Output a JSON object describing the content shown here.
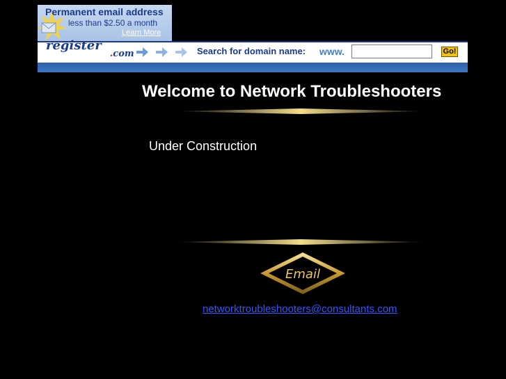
{
  "ad": {
    "title": "Permanent email address",
    "subtitle": "less than $2.50 a month",
    "learn_more": "Learn More"
  },
  "banner": {
    "logo_main": "register",
    "logo_dot": ".",
    "logo_suffix": "com",
    "search_label": "Search for domain name:",
    "prefix": "www.",
    "input_value": "",
    "go_label": "Go!"
  },
  "page": {
    "title": "Welcome to Network Troubleshooters",
    "status": "Under Construction",
    "email_button_label": "Email",
    "email_address": "networktroubleshooters@consultants.com"
  },
  "colors": {
    "background": "#000000",
    "brand_blue": "#1a3a8c",
    "gold": "#d9b24a",
    "link": "#3355ff"
  }
}
